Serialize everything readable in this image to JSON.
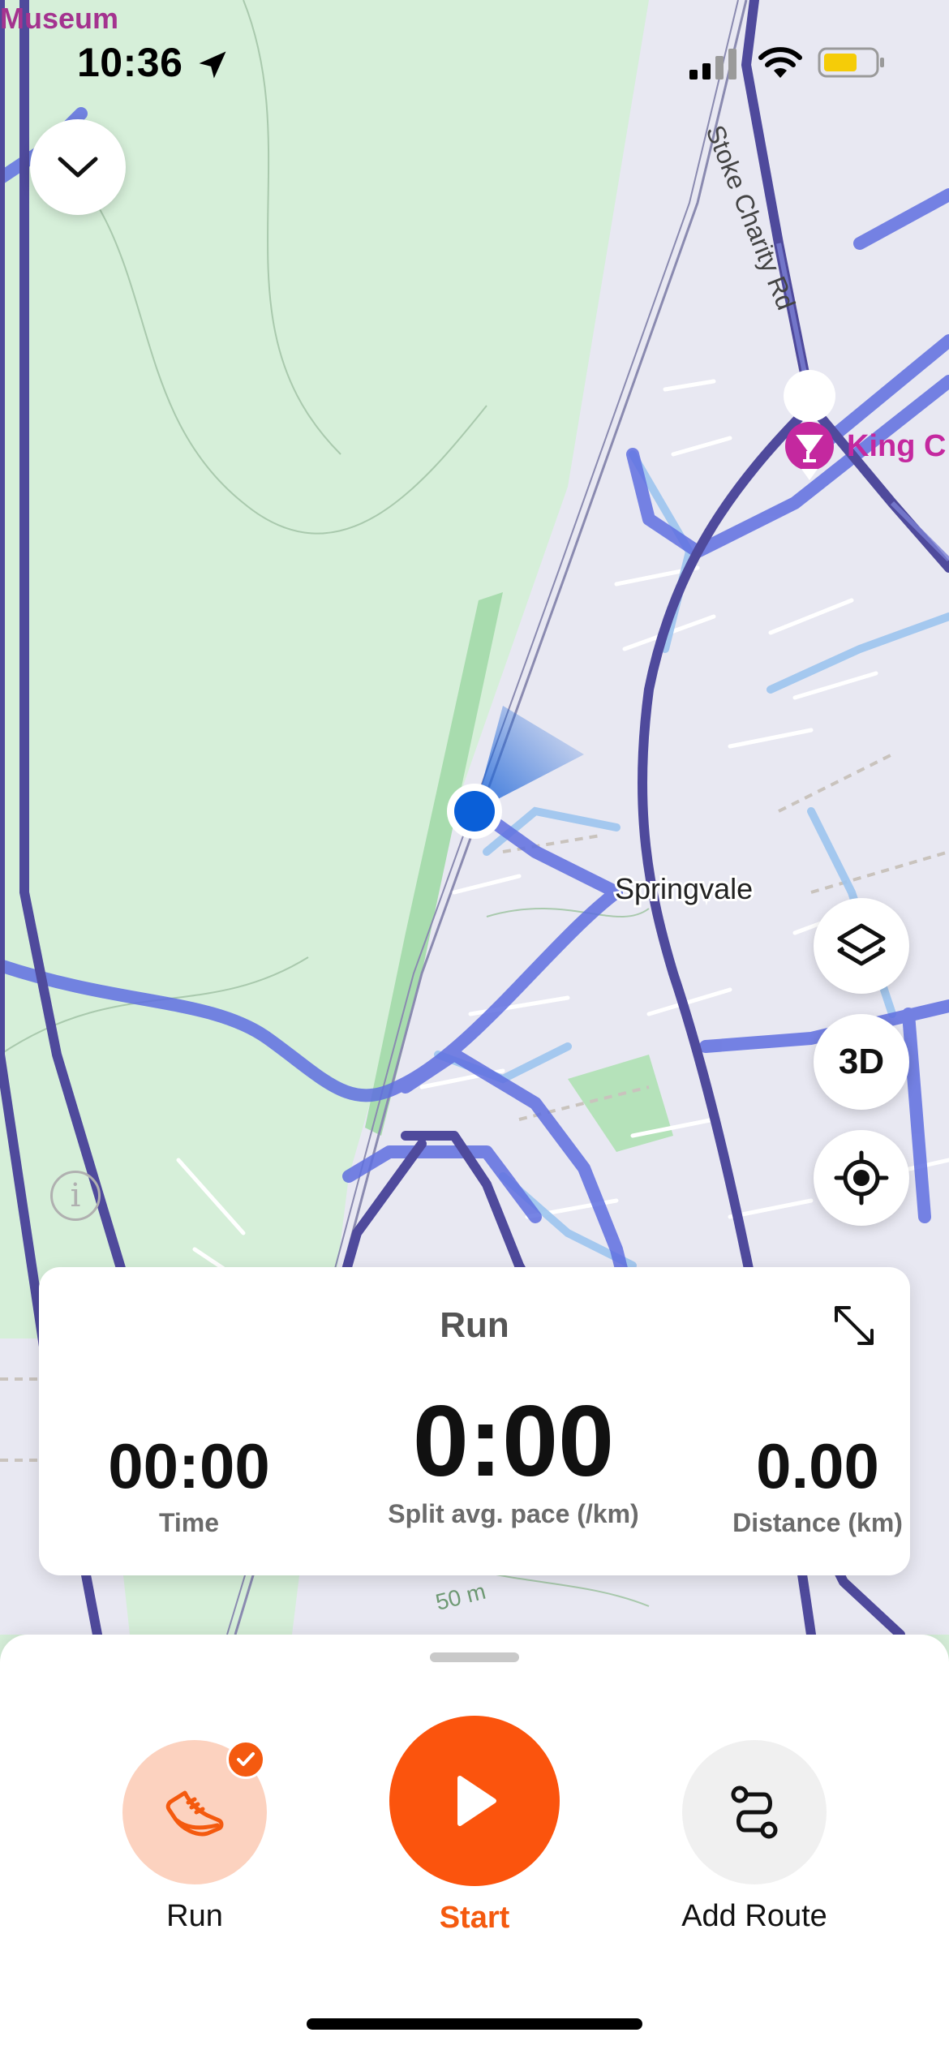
{
  "status_bar": {
    "time": "10:36"
  },
  "map": {
    "labels": {
      "museum": "Museum",
      "road": "Stoke Charity Rd",
      "poi": "King C",
      "town": "Springvale",
      "contour": "50 m"
    },
    "controls": {
      "three_d": "3D",
      "info": "i"
    }
  },
  "stats_card": {
    "title": "Run",
    "time": {
      "value": "00:00",
      "label": "Time"
    },
    "pace": {
      "value": "0:00",
      "label": "Split avg. pace (/km)"
    },
    "distance": {
      "value": "0.00",
      "label": "Distance (km)"
    }
  },
  "actions": {
    "run": "Run",
    "start": "Start",
    "add_route": "Add Route"
  },
  "colors": {
    "accent": "#FB540D",
    "accent_light": "#FCD2BF",
    "map_green": "#D6EFD9",
    "map_urban": "#E8E8F2",
    "heat_blue": "#5B6CDB",
    "heat_dark": "#4F4A9C",
    "location_dot": "#0A5FD8"
  }
}
